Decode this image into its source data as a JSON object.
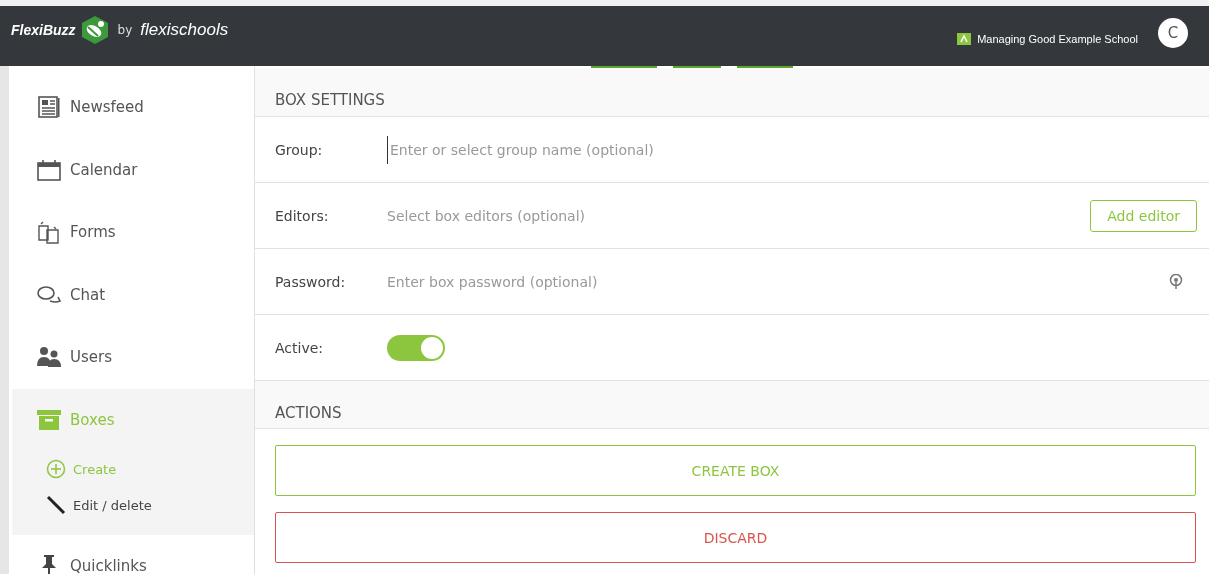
{
  "header": {
    "brand": "FlexiBuzz",
    "by": "by",
    "partner": "flexischools",
    "school": "Managing Good Example School",
    "avatar": "C"
  },
  "sidebar": {
    "items": [
      {
        "label": "Newsfeed",
        "selected": false
      },
      {
        "label": "Calendar",
        "selected": false
      },
      {
        "label": "Forms",
        "selected": false
      },
      {
        "label": "Chat",
        "selected": false
      },
      {
        "label": "Users",
        "selected": false
      },
      {
        "label": "Boxes",
        "selected": true,
        "children": [
          {
            "label": "Create",
            "selected": true
          },
          {
            "label": "Edit / delete",
            "selected": false
          }
        ]
      },
      {
        "label": "Quicklinks",
        "selected": false
      }
    ]
  },
  "settings": {
    "title": "BOX SETTINGS",
    "rows": [
      {
        "kind": "input",
        "label": "Group:",
        "placeholder": "Enter or select group name (optional)",
        "focused": true
      },
      {
        "kind": "input",
        "label": "Editors:",
        "placeholder": "Select box editors (optional)",
        "button": "Add editor"
      },
      {
        "kind": "password",
        "label": "Password:",
        "placeholder": "Enter box password (optional)"
      },
      {
        "kind": "toggle",
        "label": "Active:",
        "on": true
      }
    ]
  },
  "actions": {
    "title": "ACTIONS",
    "buttons": [
      {
        "label": "CREATE BOX",
        "kind": "primary"
      },
      {
        "label": "DISCARD",
        "kind": "danger"
      }
    ]
  }
}
